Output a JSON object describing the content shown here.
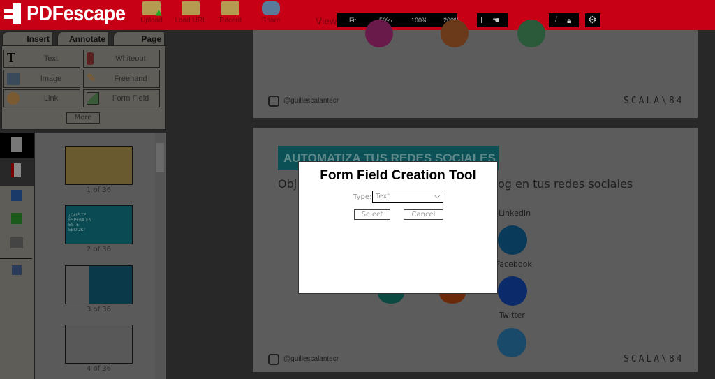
{
  "header": {
    "logo_text": "PDFescape",
    "menu": [
      {
        "label": "Upload",
        "icon": "folder-upload-icon"
      },
      {
        "label": "Load URL",
        "icon": "folder-link-icon"
      },
      {
        "label": "Recent",
        "icon": "folder-clock-icon"
      },
      {
        "label": "Share",
        "icon": "users-icon"
      }
    ],
    "view_label": "View",
    "zoom_options": [
      "Fit",
      "50%",
      "100%",
      "200%"
    ],
    "colors": {
      "brand": "#c70015"
    }
  },
  "tabs": [
    "Insert",
    "Annotate",
    "Page"
  ],
  "tools": [
    {
      "label": "Text",
      "icon": "text-T-icon"
    },
    {
      "label": "Whiteout",
      "icon": "whiteout-icon"
    },
    {
      "label": "Image",
      "icon": "image-add-icon"
    },
    {
      "label": "Freehand",
      "icon": "pencil-icon"
    },
    {
      "label": "Link",
      "icon": "link-globe-icon"
    },
    {
      "label": "Form Field",
      "icon": "form-field-icon"
    }
  ],
  "more_label": "More",
  "thumbnails": [
    {
      "caption": "1 of 36"
    },
    {
      "caption": "2 of 36",
      "text": "¿QUÉ TE ESPERA EN ESTE EBOOK?"
    },
    {
      "caption": "3 of 36"
    },
    {
      "caption": "4 of 36"
    }
  ],
  "document": {
    "handle": "@guillescalantecr",
    "brand": "SCALA\\84",
    "heading": "AUTOMATIZA TUS REDES SOCIALES",
    "subtitle_left": "Obj",
    "subtitle_right": "og en tus redes sociales",
    "networks": [
      "LinkedIn",
      "Facebook",
      "Twitter"
    ]
  },
  "dialog": {
    "title": "Form Field Creation Tool",
    "type_label": "Type:",
    "type_value": "Text",
    "select_label": "Select",
    "cancel_label": "Cancel"
  }
}
